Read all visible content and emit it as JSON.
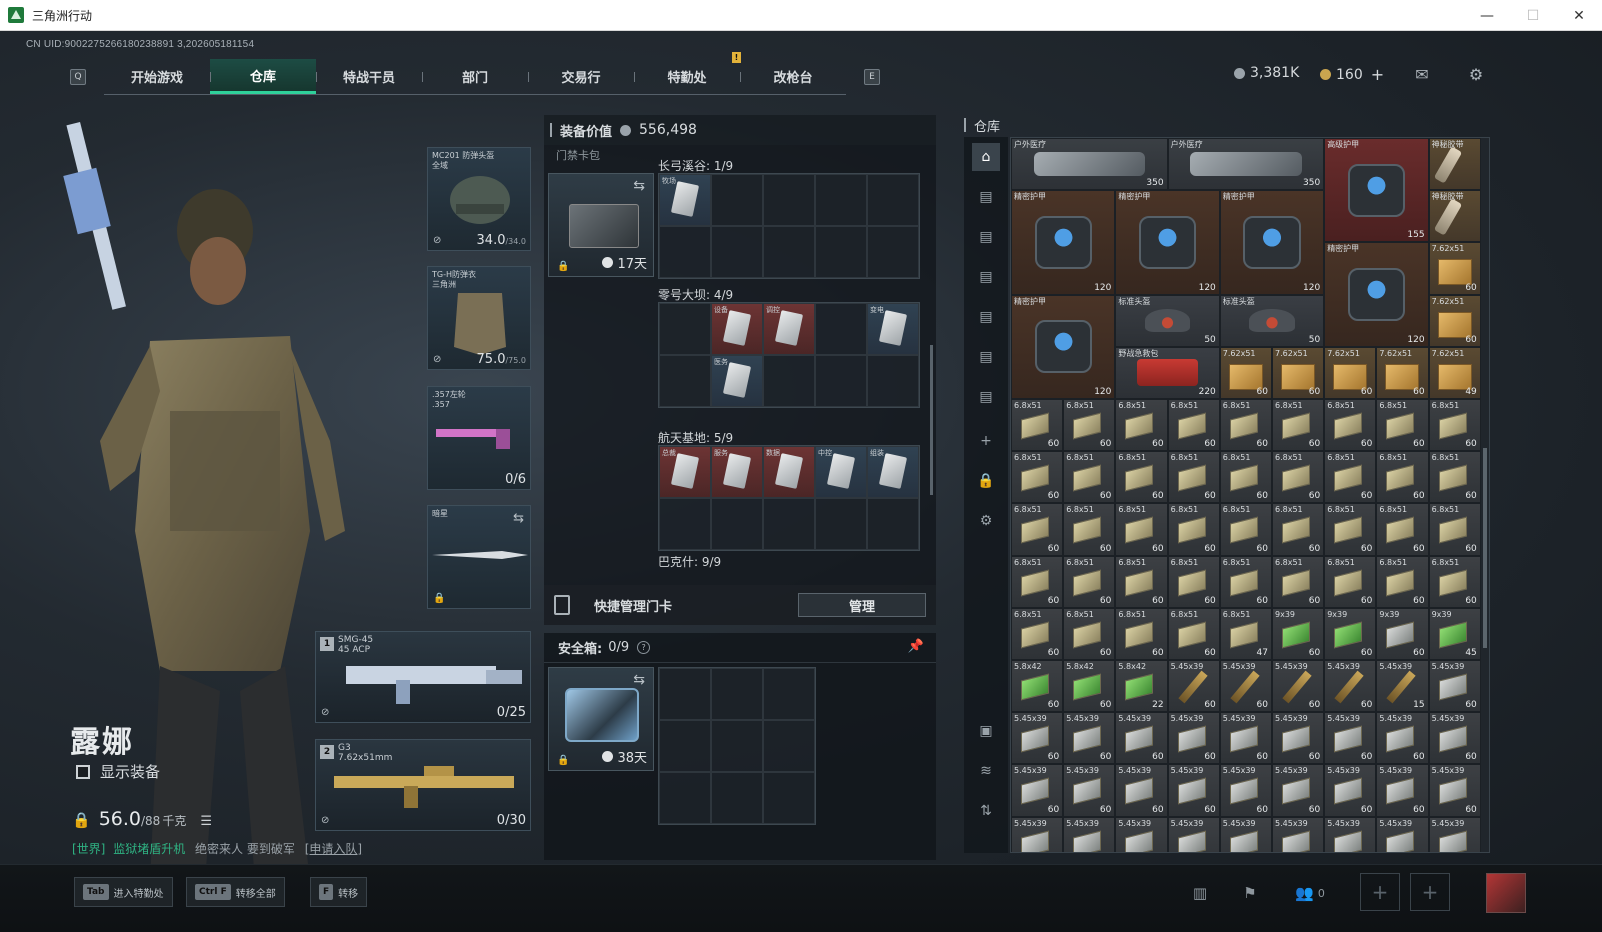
{
  "window": {
    "title": "三角洲行动"
  },
  "uid": "CN UID:9002275266180238891 3,202605181154",
  "nav": {
    "left_key": "Q",
    "right_key": "E",
    "notice": "!",
    "tabs": [
      {
        "label": "开始游戏",
        "active": false
      },
      {
        "label": "仓库",
        "active": true
      },
      {
        "label": "特战干员",
        "active": false
      },
      {
        "label": "部门",
        "active": false
      },
      {
        "label": "交易行",
        "active": false
      },
      {
        "label": "特勤处",
        "active": false
      },
      {
        "label": "改枪台",
        "active": false
      }
    ]
  },
  "currency": {
    "hafcoin": "3,381K",
    "delta_coin": "160",
    "plus": "+"
  },
  "operator": {
    "name": "露娜",
    "show_equipment": "显示装备",
    "weight_value": "56.0",
    "weight_max": "/88",
    "weight_unit": "千克"
  },
  "chat": {
    "channel": "[世界]",
    "sender": "监狱堵盾升机",
    "message": "绝密来人 要到破军",
    "link": "[申请入队]"
  },
  "equipment": {
    "helmet": {
      "label": "MC201 防弹头盔",
      "sub": "全域",
      "dur": "34.0",
      "dur_max": "/34.0"
    },
    "armor": {
      "label": "TG-H防弹衣",
      "sub": "三角洲",
      "dur": "75.0",
      "dur_max": "/75.0"
    },
    "pistol": {
      "label": ".357左轮",
      "sub": ".357",
      "ammo": "0/6"
    },
    "melee": {
      "label": "暗星"
    },
    "primary": {
      "slot": "1",
      "label": "SMG-45",
      "sub": "45 ACP",
      "ammo": "0/25"
    },
    "secondary": {
      "slot": "2",
      "label": "G3",
      "sub": "7.62x51mm",
      "ammo": "0/30"
    }
  },
  "mid": {
    "value_label": "装备价值",
    "value": "556,498",
    "card_pack_label": "门禁卡包",
    "card_days": "17天",
    "zones": [
      {
        "title": "长弓溪谷: 1/9",
        "cards": [
          "牧场"
        ]
      },
      {
        "title": "零号大坝: 4/9",
        "cards": [
          "设备",
          "调控",
          "变电",
          "医务"
        ]
      },
      {
        "title": "航天基地: 5/9",
        "cards": [
          "总裁",
          "服务",
          "数据",
          "中控",
          "组装"
        ]
      },
      {
        "title": "巴克什: 9/9",
        "cards": []
      }
    ],
    "quick_label": "快捷管理门卡",
    "quick_button": "管理",
    "safe_label": "安全箱:",
    "safe_value": "0/9",
    "safe_days": "38天"
  },
  "warehouse": {
    "title": "仓库",
    "items": {
      "outdoor_med": "户外医疗",
      "sealed_armor": "精密护甲",
      "advanced_armor": "高级护甲",
      "standard_helmet": "标准头盔",
      "field_kit": "野战急救包",
      "tape": "神秘胶带",
      "ammo_68": "6.8x51",
      "ammo_762": "7.62x51",
      "ammo_939": "9x39",
      "ammo_58": "5.8x42",
      "ammo_545": "5.45x39"
    },
    "counts": {
      "c350": "350",
      "c155": "155",
      "c120": "120",
      "c50": "50",
      "c220": "220",
      "c60": "60",
      "c49": "49",
      "c47": "47",
      "c45": "45",
      "c22": "22",
      "c15": "15"
    }
  },
  "bottom": {
    "hints": [
      {
        "key": "Tab",
        "label": "进入特勤处"
      },
      {
        "key": "Ctrl F",
        "label": "转移全部"
      },
      {
        "key": "F",
        "label": "转移"
      }
    ],
    "party_count": "0",
    "add": "+"
  }
}
